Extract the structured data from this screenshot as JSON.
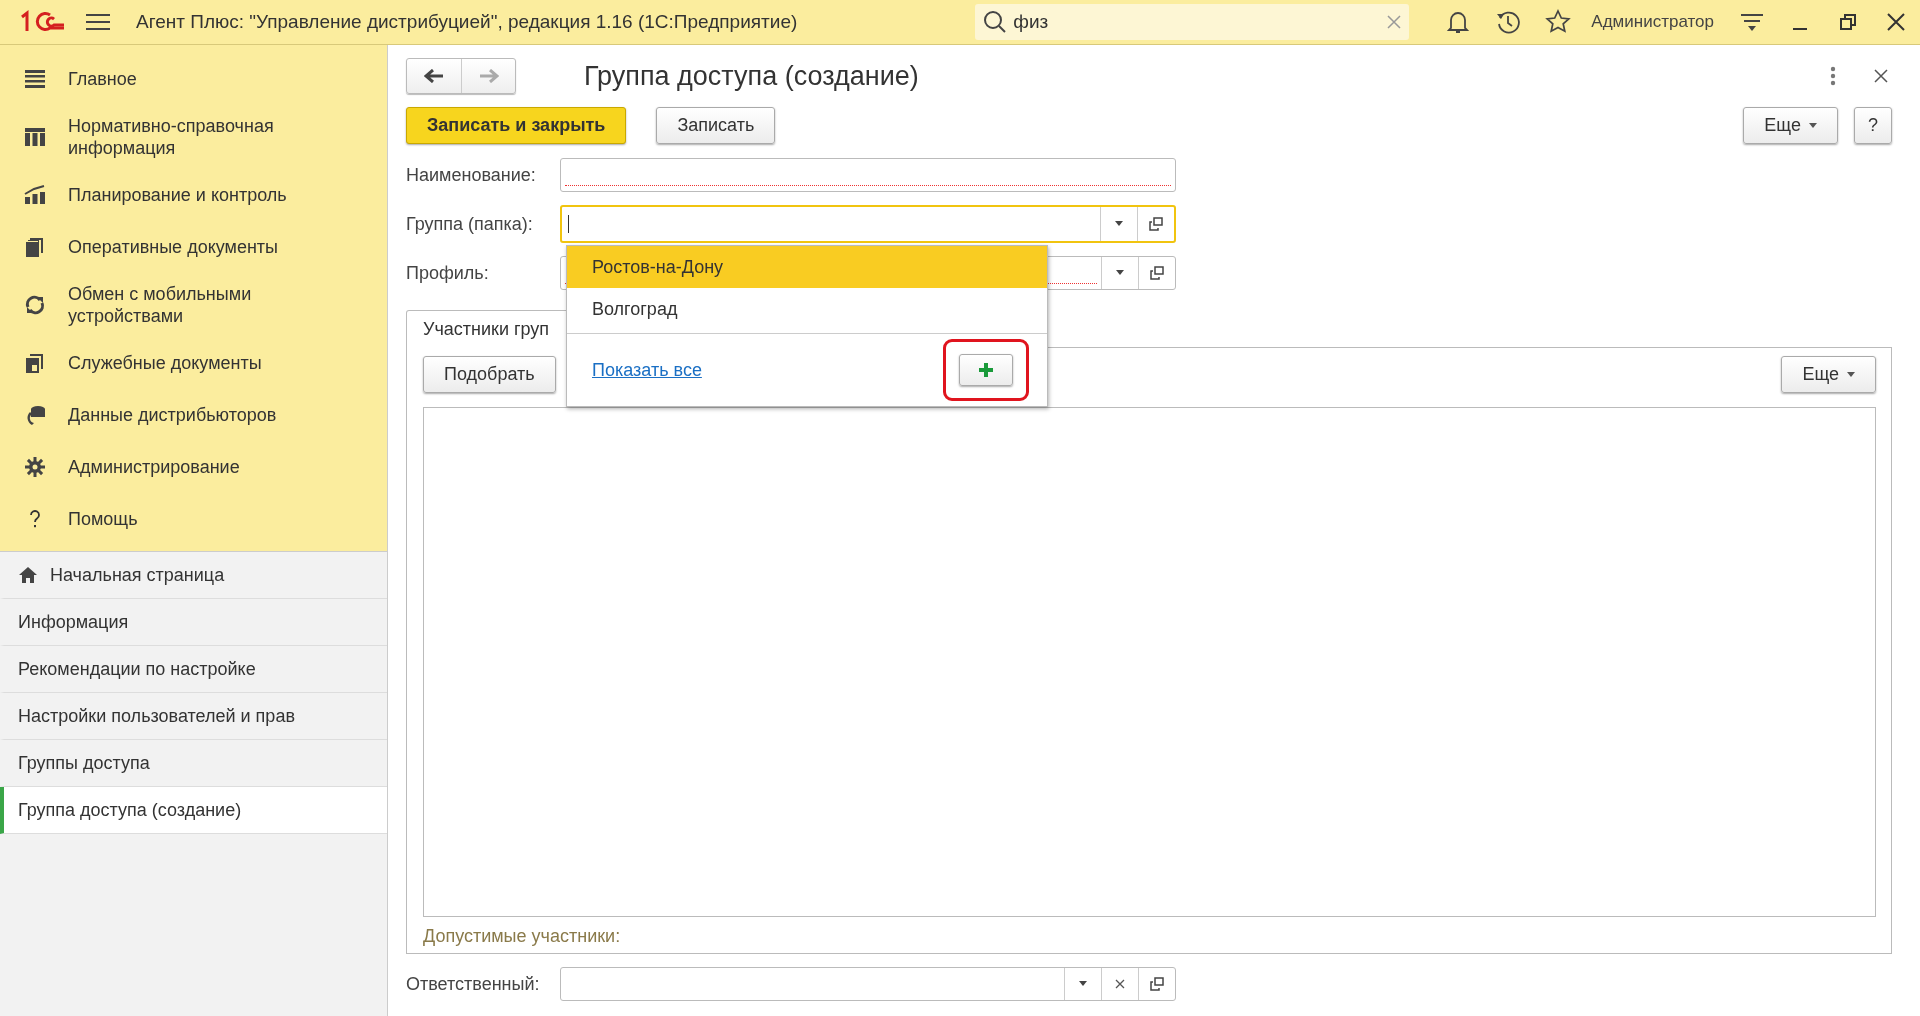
{
  "app_bar": {
    "title": "Агент Плюс: \"Управление дистрибуцией\", редакция 1.16  (1С:Предприятие)",
    "search": {
      "value": "физ"
    },
    "user": "Администратор"
  },
  "sections": [
    {
      "label": "Главное",
      "kind": "menu"
    },
    {
      "label": "Нормативно-справочная информация",
      "kind": "catalog"
    },
    {
      "label": "Планирование и контроль",
      "kind": "chart"
    },
    {
      "label": "Оперативные документы",
      "kind": "docs"
    },
    {
      "label": "Обмен с мобильными устройствами",
      "kind": "sync"
    },
    {
      "label": "Служебные документы",
      "kind": "service"
    },
    {
      "label": "Данные дистрибьюторов",
      "kind": "data"
    },
    {
      "label": "Администрирование",
      "kind": "gear"
    },
    {
      "label": "Помощь",
      "kind": "help"
    }
  ],
  "open_windows": [
    {
      "label": "Начальная страница",
      "kind": "home",
      "selected": false
    },
    {
      "label": "Информация",
      "kind": "page",
      "selected": false
    },
    {
      "label": "Рекомендации по настройке",
      "kind": "page",
      "selected": false
    },
    {
      "label": "Настройки пользователей и прав",
      "kind": "page",
      "selected": false
    },
    {
      "label": "Группы доступа",
      "kind": "page",
      "selected": false
    },
    {
      "label": "Группа доступа (создание)",
      "kind": "page",
      "selected": true
    }
  ],
  "form": {
    "title": "Группа доступа (создание)",
    "buttons": [
      {
        "label": "Записать и закрыть",
        "kind": "default"
      },
      {
        "label": "Записать",
        "kind": "plain"
      }
    ],
    "more": "Еще",
    "help": "?",
    "fields": [
      {
        "label": "Наименование:",
        "required": true,
        "focused": false,
        "kind": "text"
      },
      {
        "label": "Группа (папка):",
        "required": false,
        "focused": true,
        "kind": "choice"
      },
      {
        "label": "Профиль:",
        "required": true,
        "focused": false,
        "kind": "choice"
      }
    ],
    "dropdown": {
      "items": [
        {
          "label": "Ростов-на-Дону",
          "selected": true
        },
        {
          "label": "Волгоград",
          "selected": false
        }
      ],
      "link": "Показать все"
    },
    "members": {
      "tab": "Участники груп",
      "pick": "Подобрать",
      "more": "Еще",
      "note": "Допустимые участники:"
    },
    "responsible": {
      "label": "Ответственный:",
      "kind": "clearable_choice"
    }
  }
}
